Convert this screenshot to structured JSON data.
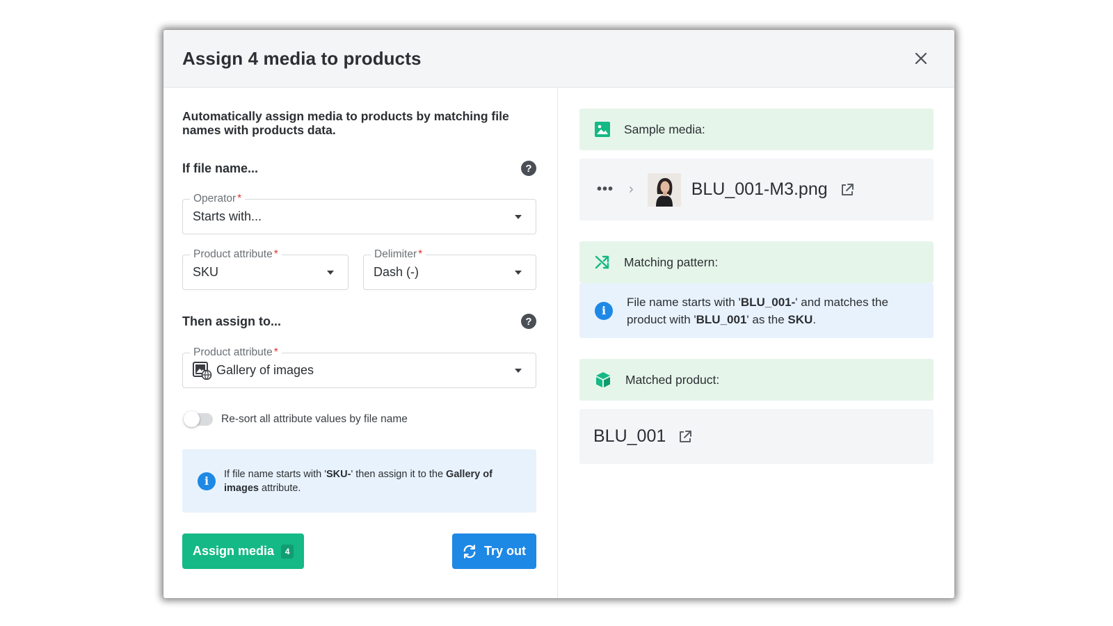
{
  "dialog": {
    "title": "Assign 4 media to products",
    "close_icon": "close-icon"
  },
  "left": {
    "intro": "Automatically assign media to products by matching file names with products data.",
    "if_section": {
      "title": "If file name..."
    },
    "operator": {
      "label": "Operator",
      "required_mark": "*",
      "value": "Starts with..."
    },
    "product_attribute": {
      "label": "Product attribute",
      "required_mark": "*",
      "value": "SKU"
    },
    "delimiter": {
      "label": "Delimiter",
      "required_mark": "*",
      "value": "Dash (-)"
    },
    "then_section": {
      "title": "Then assign to..."
    },
    "target_attribute": {
      "label": "Product attribute",
      "required_mark": "*",
      "value": "Gallery of images",
      "icon": "gallery-icon"
    },
    "resort_toggle": {
      "label": "Re-sort all attribute values by file name",
      "enabled": false
    },
    "info": {
      "part1": "If file name starts with '",
      "bold1": "SKU-",
      "part2": "' then assign it to the ",
      "bold2": "Gallery of images",
      "part3": " attribute."
    },
    "assign_button": {
      "label": "Assign media",
      "count": "4"
    },
    "try_button": {
      "label": "Try out",
      "icon": "refresh-icon"
    }
  },
  "right": {
    "sample": {
      "title": "Sample media:",
      "icon": "image-icon",
      "more": "•••",
      "file_name": "BLU_001-M3.png"
    },
    "pattern": {
      "title": "Matching pattern:",
      "icon": "shuffle-icon",
      "part1": "File name starts with '",
      "bold1": "BLU_001-",
      "part2": "' and matches the product with '",
      "bold2": "BLU_001",
      "part3": "' as the ",
      "bold3": "SKU",
      "part4": "."
    },
    "matched": {
      "title": "Matched product:",
      "icon": "cube-icon",
      "product": "BLU_001"
    }
  },
  "colors": {
    "primary_green": "#14b985",
    "primary_blue": "#1e88e5",
    "info_bg": "#e8f2fc",
    "success_bg": "#e6f5ea"
  }
}
